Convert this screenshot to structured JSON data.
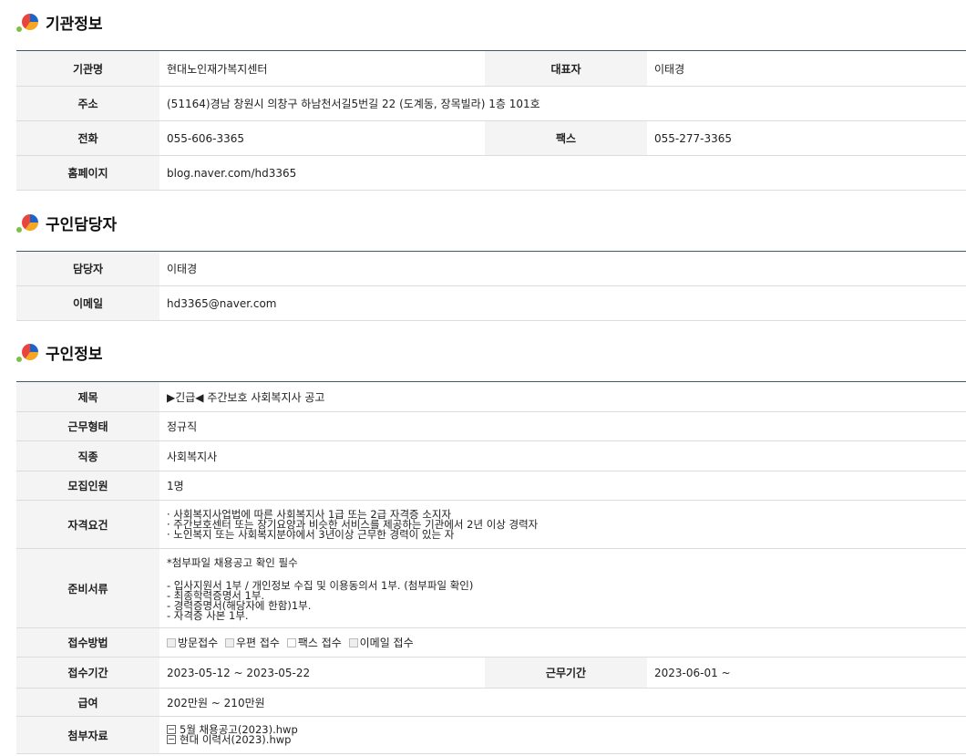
{
  "sections": {
    "org": {
      "title": "기관정보"
    },
    "contact": {
      "title": "구인담당자"
    },
    "job": {
      "title": "구인정보"
    }
  },
  "org": {
    "name_label": "기관명",
    "name": "현대노인재가복지센터",
    "rep_label": "대표자",
    "rep": "이태경",
    "addr_label": "주소",
    "addr": "(51164)경남 창원시 의창구 하남천서길5번길 22 (도계동, 장목빌라) 1층 101호",
    "tel_label": "전화",
    "tel": "055-606-3365",
    "fax_label": "팩스",
    "fax": "055-277-3365",
    "home_label": "홈페이지",
    "home": "blog.naver.com/hd3365"
  },
  "contact": {
    "person_label": "담당자",
    "person": "이태경",
    "email_label": "이메일",
    "email": "hd3365@naver.com"
  },
  "job": {
    "title_label": "제목",
    "title": "▶긴급◀ 주간보호 사회복지사 공고",
    "type_label": "근무형태",
    "type": "정규직",
    "occ_label": "직종",
    "occ": "사회복지사",
    "count_label": "모집인원",
    "count": "1명",
    "qual_label": "자격요건",
    "qual": "· 사회복지사업법에 따른 사회복지사 1급 또는 2급 자격증 소지자\n· 주간보호센터 또는 장기요양과 비슷한 서비스를 제공하는 기관에서 2년 이상 경력자\n· 노인복지 또는 사회복지분야에서 3년이상 근무한 경력이 있는 자",
    "docs_label": "준비서류",
    "docs_head": "*첨부파일 채용공고 확인 필수",
    "docs": "- 입사지원서 1부 / 개인정보 수집 및 이용동의서 1부. (첨부파일 확인)\n- 최종학력증명서 1부.\n- 경력증명서(해당자에 한함)1부.\n- 자격증 사본 1부.",
    "method_label": "접수방법",
    "methods": [
      "방문접수",
      "우편 접수",
      "팩스 접수",
      "이메일 접수"
    ],
    "period_label": "접수기간",
    "period": "2023-05-12 ~ 2023-05-22",
    "workperiod_label": "근무기간",
    "workperiod": "2023-06-01 ~",
    "pay_label": "급여",
    "pay": "202만원 ~ 210만원",
    "attach_label": "첨부자료",
    "files": [
      "5월 채용공고(2023).hwp",
      "현대 이력서(2023).hwp"
    ]
  }
}
